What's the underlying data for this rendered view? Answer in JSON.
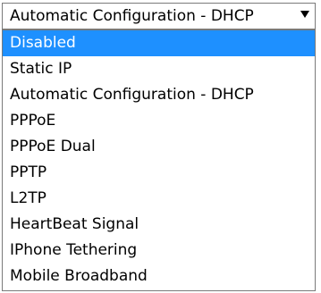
{
  "select": {
    "current_value": "Automatic Configuration - DHCP",
    "arrow_icon": "triangle-down",
    "highlight_color": "#1e90ff"
  },
  "options": [
    {
      "label": "Disabled",
      "highlighted": true
    },
    {
      "label": "Static IP",
      "highlighted": false
    },
    {
      "label": "Automatic Configuration - DHCP",
      "highlighted": false
    },
    {
      "label": "PPPoE",
      "highlighted": false
    },
    {
      "label": "PPPoE Dual",
      "highlighted": false
    },
    {
      "label": "PPTP",
      "highlighted": false
    },
    {
      "label": "L2TP",
      "highlighted": false
    },
    {
      "label": "HeartBeat Signal",
      "highlighted": false
    },
    {
      "label": "IPhone Tethering",
      "highlighted": false
    },
    {
      "label": "Mobile Broadband",
      "highlighted": false
    }
  ]
}
